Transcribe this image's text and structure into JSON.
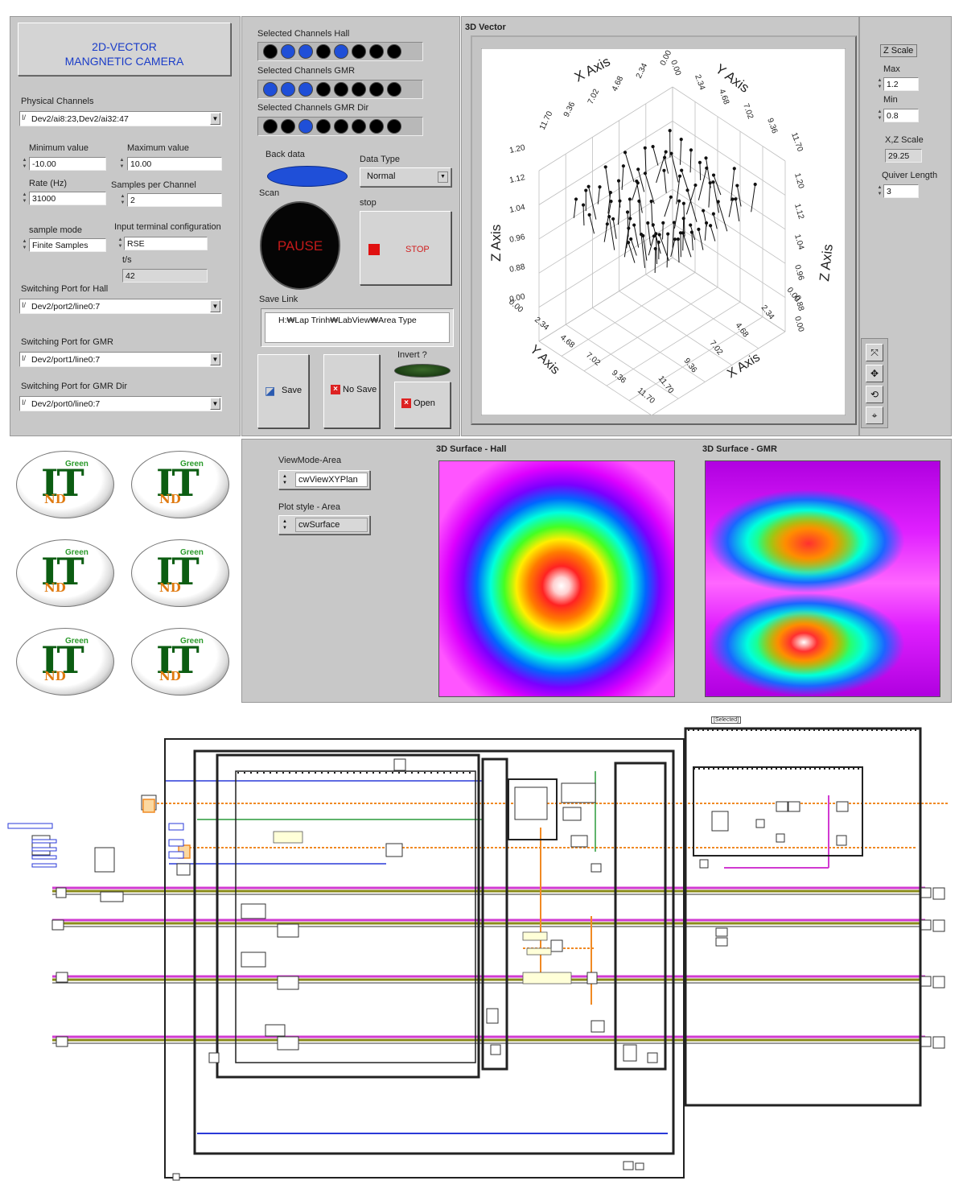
{
  "front": {
    "title_line1": "2D-VECTOR",
    "title_line2": "MANGNETIC CAMERA",
    "physical_channels_label": "Physical Channels",
    "physical_channels_value": "Dev2/ai8:23,Dev2/ai32:47",
    "min_label": "Minimum value",
    "min_value": "-10.00",
    "max_label": "Maximum value",
    "max_value": "10.00",
    "rate_label": "Rate (Hz)",
    "rate_value": "31000",
    "samples_label": "Samples per Channel",
    "samples_value": "2",
    "sample_mode_label": "sample mode",
    "sample_mode_value": "Finite Samples",
    "terminal_label": "Input terminal configuration",
    "terminal_value": "RSE",
    "ts_label": "t/s",
    "ts_value": "42",
    "hall_port_label": "Switching Port for Hall",
    "hall_port_value": "Dev2/port2/line0:7",
    "gmr_port_label": "Switching Port for GMR",
    "gmr_port_value": "Dev2/port1/line0:7",
    "gmrdir_port_label": "Switching Port for GMR Dir",
    "gmrdir_port_value": "Dev2/port0/line0:7"
  },
  "channels": {
    "hall_label": "Selected Channels Hall",
    "hall": [
      false,
      true,
      true,
      false,
      true,
      false,
      false,
      false
    ],
    "gmr_label": "Selected Channels GMR",
    "gmr": [
      true,
      true,
      true,
      false,
      false,
      false,
      false,
      false
    ],
    "gmrdir_label": "Selected Channels GMR Dir",
    "gmrdir": [
      false,
      false,
      true,
      false,
      false,
      false,
      false,
      false
    ]
  },
  "controls": {
    "back_data_label": "Back data",
    "data_type_label": "Data Type",
    "data_type_value": "Normal",
    "scan_label": "Scan",
    "pause_text": "PAUSE",
    "stop_label": "stop",
    "stop_text": "STOP",
    "save_link_label": "Save Link",
    "save_link_value": "H:₩Lap Trinh₩LabView₩Area Type",
    "invert_label": "Invert ?",
    "save_btn": "Save",
    "nosave_btn": "No Save",
    "open_btn": "Open"
  },
  "vector3d": {
    "title": "3D Vector",
    "x_axis": "X Axis",
    "y_axis": "Y Axis",
    "z_axis": "Z Axis",
    "xy_ticks": [
      "11.70",
      "9.36",
      "7.02",
      "4.68",
      "2.34",
      "0.00"
    ],
    "z_ticks": [
      "1.20",
      "1.12",
      "1.04",
      "0.96",
      "0.88",
      "0.00"
    ],
    "z_ticks_right": [
      "1.20",
      "1.12",
      "1.04",
      "0.96",
      "0.88"
    ],
    "bottom_x_ticks": [
      "11.70",
      "9.36",
      "7.02",
      "4.68",
      "2.34",
      "0.00"
    ],
    "bottom_y_ticks": [
      "0.00",
      "2.34",
      "4.68",
      "7.02",
      "9.36",
      "11.70"
    ]
  },
  "zscale": {
    "title": "Z Scale",
    "max_label": "Max",
    "max_value": "1.2",
    "min_label": "Min",
    "min_value": "0.8",
    "xz_label": "X,Z Scale",
    "xz_value": "29.25",
    "quiver_label": "Quiver Length",
    "quiver_value": "3"
  },
  "surface": {
    "viewmode_label": "ViewMode-Area",
    "viewmode_value": "cwViewXYPlan",
    "plotstyle_label": "Plot style - Area",
    "plotstyle_value": "cwSurface",
    "hall_title": "3D Surface - Hall",
    "gmr_title": "3D Surface - GMR"
  },
  "logo": {
    "letters": "IT",
    "green": "Green",
    "nd": "ND"
  },
  "diagram": {
    "status_label": "[Selected]"
  },
  "colors": {
    "panel": "#c8c8c8",
    "led_on": "#1f4fd8",
    "wire_orange": "#f08a24",
    "wire_magenta": "#d13ad1",
    "wire_olive": "#8a8a1a",
    "wire_blue": "#2a3ad8",
    "wire_green": "#2a9a3a"
  }
}
